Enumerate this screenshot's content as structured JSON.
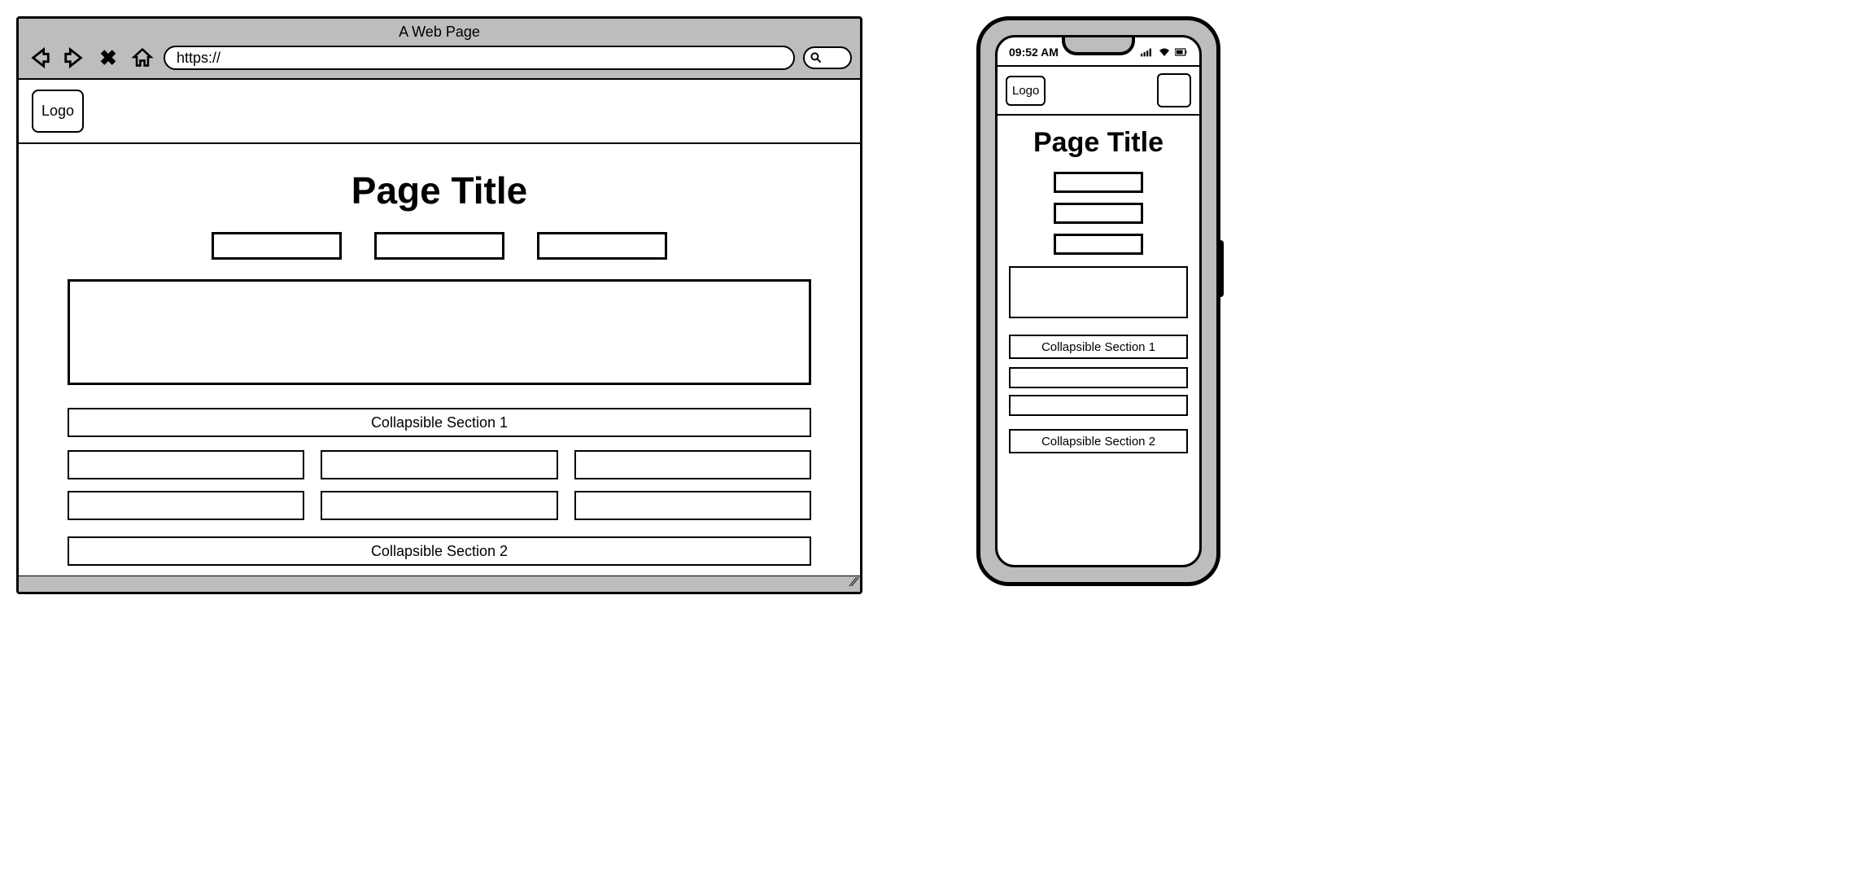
{
  "browser": {
    "window_title": "A Web Page",
    "url": "https://",
    "logo": "Logo",
    "page_title": "Page Title",
    "collapsible_1": "Collapsible Section 1",
    "collapsible_2": "Collapsible Section 2"
  },
  "phone": {
    "time": "09:52 AM",
    "logo": "Logo",
    "page_title": "Page Title",
    "collapsible_1": "Collapsible Section 1",
    "collapsible_2": "Collapsible Section 2"
  }
}
